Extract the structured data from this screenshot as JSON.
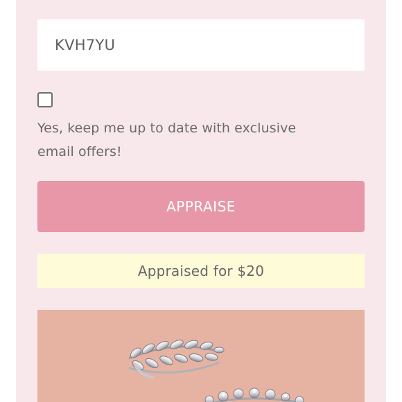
{
  "form": {
    "code_value": "KVH7YU",
    "offers_checked": false,
    "offers_label": "Yes, keep me up to date with exclusive email offers!",
    "submit_label": "APPRAISE"
  },
  "result": {
    "text": "Appraised for $20"
  },
  "product_image": {
    "subject": "silver leaf rings",
    "background_color": "#e6b3a2"
  },
  "colors": {
    "panel_bg": "#f8e8ec",
    "button_bg": "#e797a8",
    "result_bg": "#fdfbd8"
  }
}
